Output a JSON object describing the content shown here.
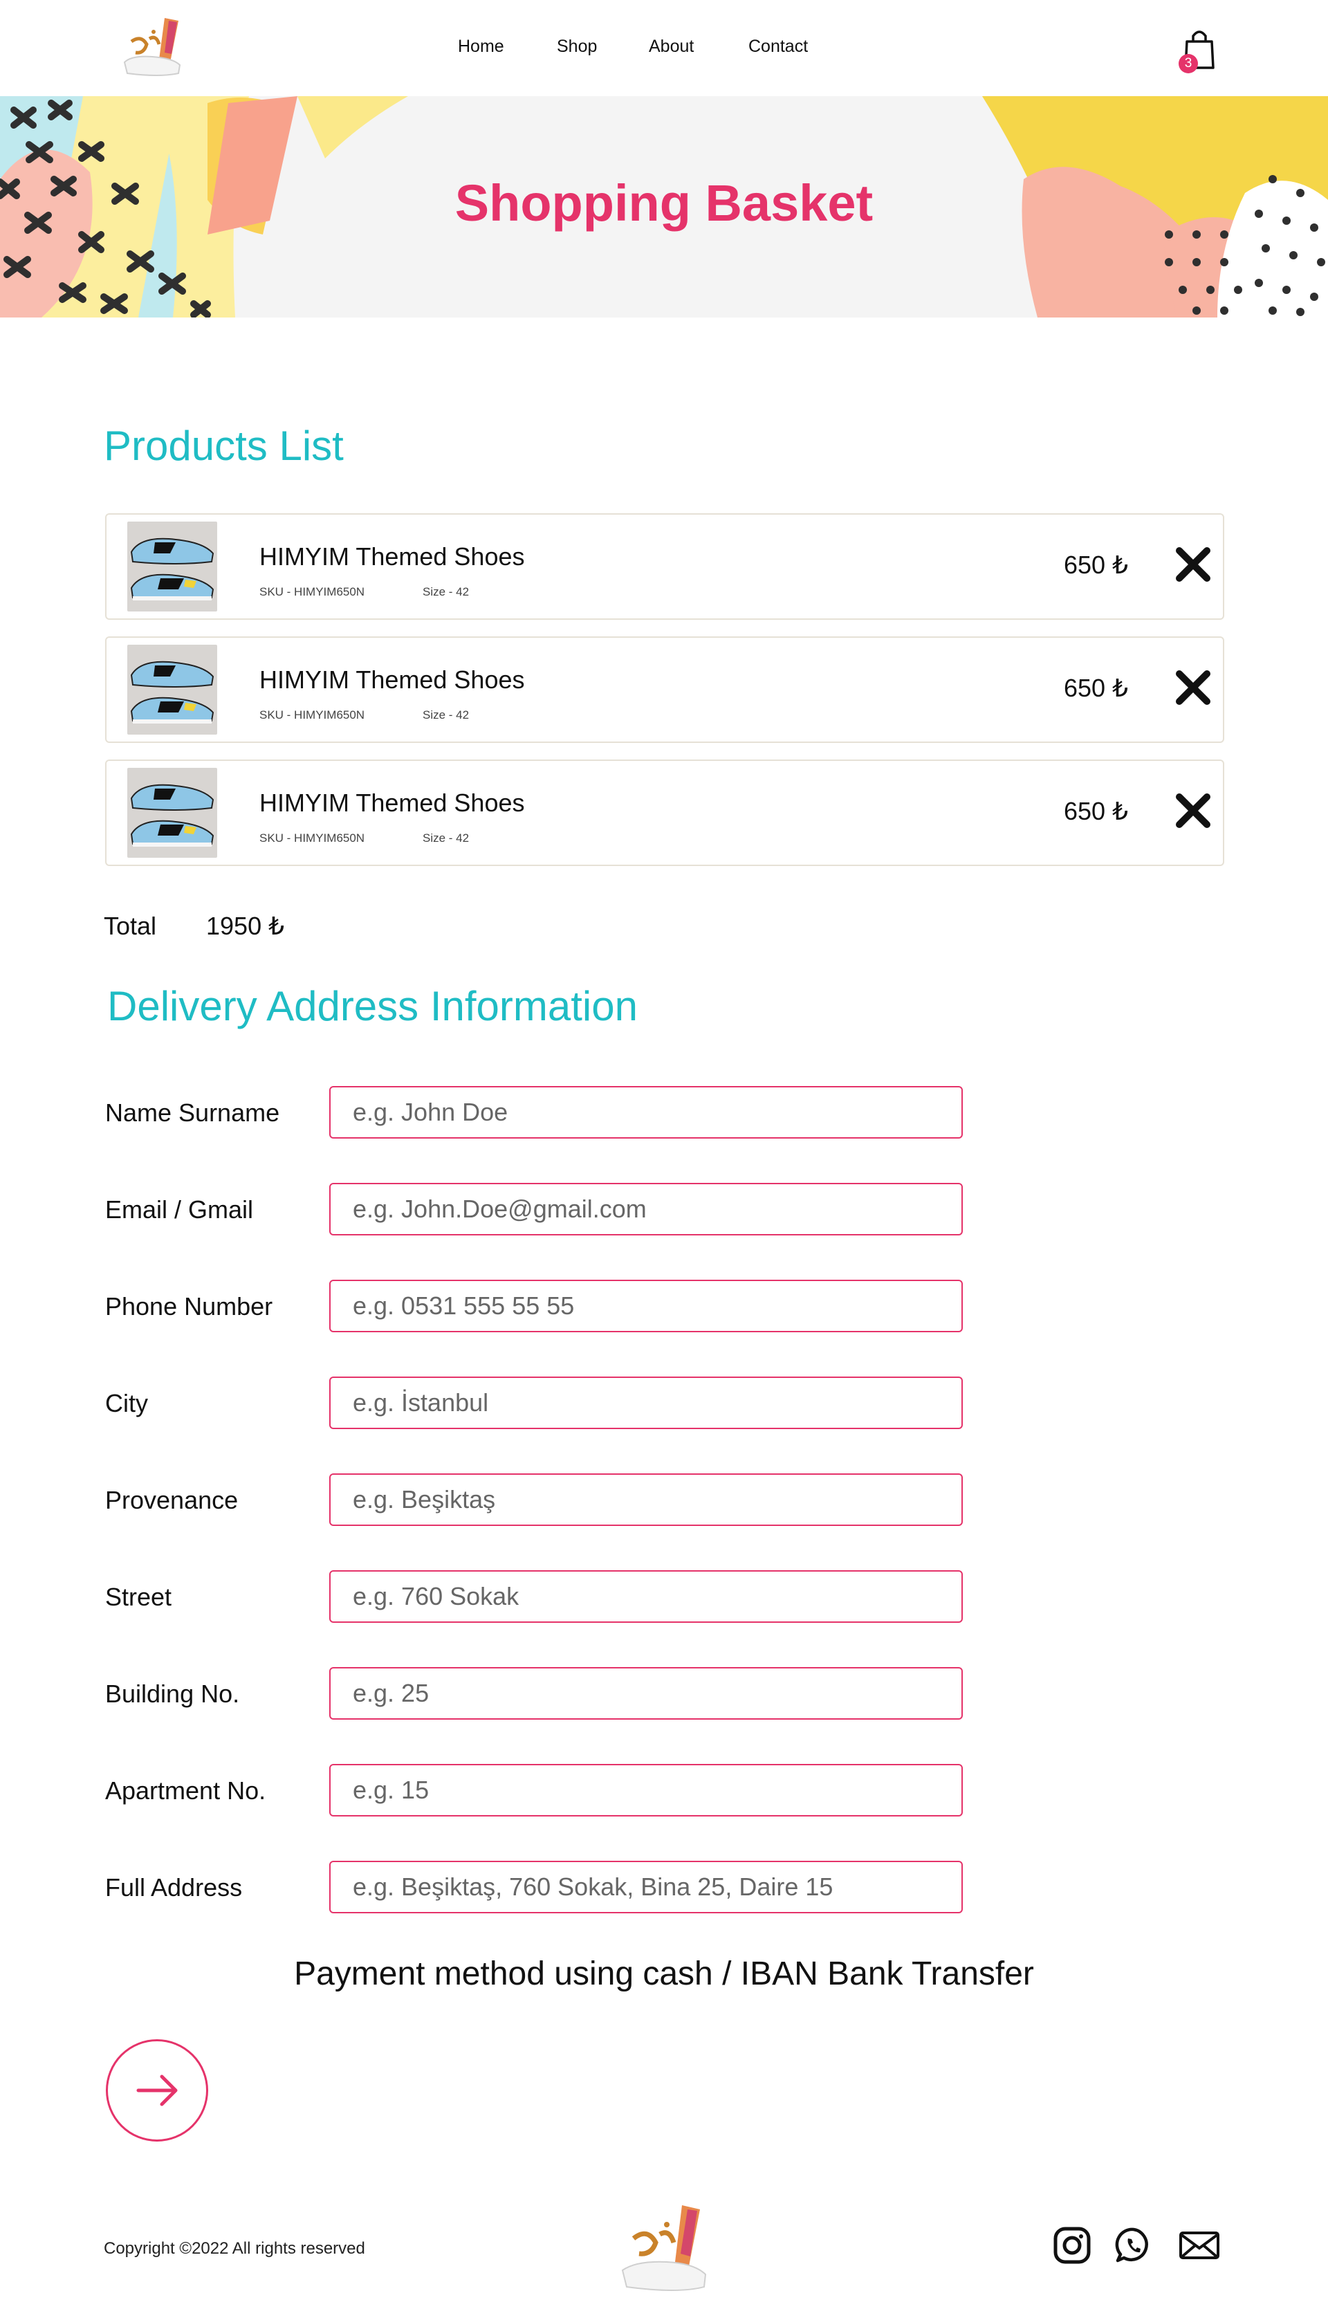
{
  "header": {
    "logo_alt": "Splash By Noor",
    "nav": [
      "Home",
      "Shop",
      "About",
      "Contact"
    ],
    "cart_count": "3"
  },
  "banner": {
    "title": "Shopping Basket"
  },
  "products": {
    "title": "Products List",
    "items": [
      {
        "name": "HIMYIM Themed Shoes",
        "sku": "SKU - HIMYIM650N",
        "size": "Size - 42",
        "price": "650 ₺"
      },
      {
        "name": "HIMYIM Themed Shoes",
        "sku": "SKU - HIMYIM650N",
        "size": "Size - 42",
        "price": "650 ₺"
      },
      {
        "name": "HIMYIM Themed Shoes",
        "sku": "SKU - HIMYIM650N",
        "size": "Size - 42",
        "price": "650 ₺"
      }
    ],
    "total_label": "Total",
    "total_value": "1950 ₺"
  },
  "delivery": {
    "title": "Delivery Address Information",
    "fields": [
      {
        "label": "Name Surname",
        "placeholder": "e.g. John Doe",
        "value": ""
      },
      {
        "label": "Email / Gmail",
        "placeholder": "e.g. John.Doe@gmail.com",
        "value": ""
      },
      {
        "label": "Phone Number",
        "placeholder": "e.g. 0531 555 55 55",
        "value": ""
      },
      {
        "label": "City",
        "placeholder": "e.g. İstanbul",
        "value": ""
      },
      {
        "label": "Provenance",
        "placeholder": "e.g. Beşiktaş",
        "value": ""
      },
      {
        "label": "Street",
        "placeholder": "e.g. 760 Sokak",
        "value": ""
      },
      {
        "label": "Building No.",
        "placeholder": "e.g. 25",
        "value": ""
      },
      {
        "label": "Apartment No.",
        "placeholder": "e.g. 15",
        "value": ""
      },
      {
        "label": "Full Address",
        "placeholder": "e.g. Beşiktaş, 760 Sokak, Bina 25, Daire 15",
        "value": ""
      }
    ],
    "payment_note": "Payment method using cash / IBAN Bank Transfer"
  },
  "footer": {
    "copyright": "Copyright ©2022 All rights reserved",
    "socials": [
      "instagram-icon",
      "whatsapp-icon",
      "mail-icon"
    ]
  },
  "colors": {
    "accent": "#e5336a",
    "teal": "#1fbcc4",
    "card_border": "#e6e1d6"
  }
}
